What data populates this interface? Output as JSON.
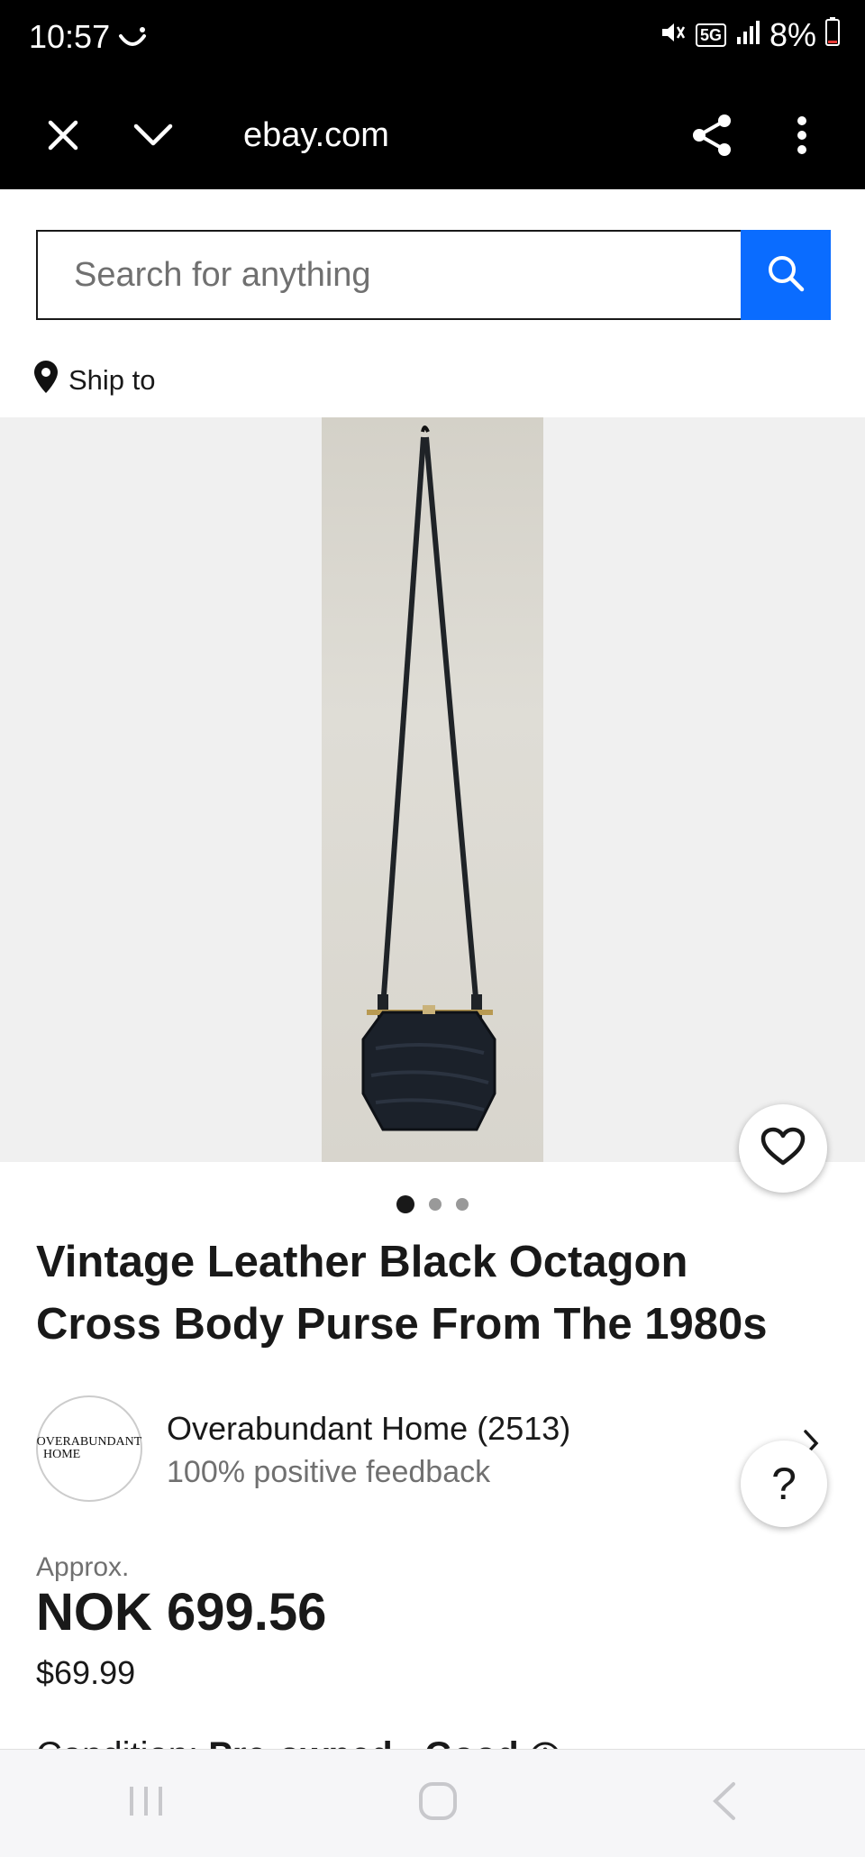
{
  "status": {
    "time": "10:57",
    "network": "5G",
    "battery": "8%"
  },
  "browser": {
    "url": "ebay.com"
  },
  "search": {
    "placeholder": "Search for anything"
  },
  "ship_to": "Ship to",
  "gallery": {
    "image_count": 3,
    "active_index": 0
  },
  "listing": {
    "title": "Vintage Leather Black Octagon Cross Body Purse From The 1980s"
  },
  "seller": {
    "logo_line1": "OVERABUNDANT",
    "logo_line2": "HOME",
    "name": "Overabundant Home (2513)",
    "feedback": "100% positive feedback"
  },
  "help": {
    "label": "?"
  },
  "price": {
    "approx_label": "Approx.",
    "local": "NOK 699.56",
    "usd": "$69.99"
  },
  "condition": {
    "label": "Condition:",
    "value": "Pre-owned - Good"
  },
  "colors": {
    "accent": "#0a6cff",
    "text": "#191919",
    "muted": "#707070"
  }
}
